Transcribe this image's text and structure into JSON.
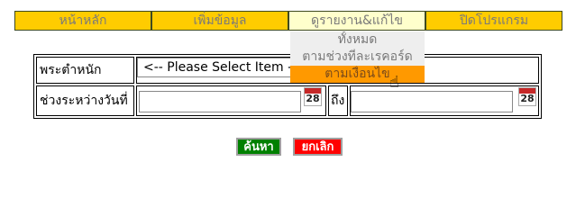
{
  "nav": {
    "items": [
      "หน้าหลัก",
      "เพิ่มข้อมูล",
      "ดูรายงาน&แก้ไข",
      "ปิดโปรแกรม"
    ]
  },
  "dropdown": {
    "items": [
      "ทั้งหมด",
      "ตามช่วงที่ละเรคอร์ด",
      "ตามเงื่อนไข"
    ],
    "highlighted": "ตามเงื่อนไข"
  },
  "form": {
    "position_label": "พระตำหนัก",
    "position_select_value": "<-- Please Select Item -->",
    "date_range_label": "ช่วงระหว่างวันที่",
    "to_label": "ถึง",
    "date_from_value": "",
    "date_to_value": ""
  },
  "calendar": {
    "day": "28"
  },
  "buttons": {
    "search": "ค้นหา",
    "cancel": "ยกเลิก"
  },
  "colors": {
    "nav_bg": "#ffcc00",
    "nav_active_bg": "#ffffcc",
    "dropdown_bg": "#eeeeee",
    "dropdown_highlight": "#ff9900",
    "search_button": "#008000",
    "cancel_button": "#ff0000"
  },
  "icons": [
    "calendar-icon",
    "hand-pointer-icon",
    "chevron-down-icon"
  ]
}
